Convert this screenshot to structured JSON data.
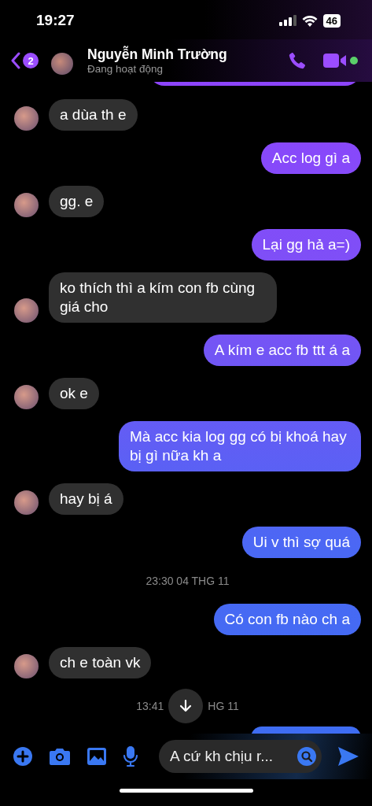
{
  "status_bar": {
    "time": "19:27",
    "battery": "46"
  },
  "header": {
    "back_count": "2",
    "name": "Nguyễn Minh Trường",
    "status": "Đang hoạt động",
    "online": true
  },
  "messages": [
    {
      "kind": "cut_out"
    },
    {
      "kind": "in",
      "text": "a dùa th e"
    },
    {
      "kind": "out",
      "text": "Acc log gì a"
    },
    {
      "kind": "in",
      "text": "gg. e"
    },
    {
      "kind": "out",
      "text": "Lại gg hả a=)"
    },
    {
      "kind": "in",
      "text": "ko thích thì a kím con fb cùng giá cho"
    },
    {
      "kind": "out",
      "text": "A kím e acc fb ttt á a"
    },
    {
      "kind": "in",
      "text": "ok e"
    },
    {
      "kind": "out",
      "text": "Mà acc kia log gg có bị khoá hay bị gì nữa kh a"
    },
    {
      "kind": "in",
      "text": "hay bị á"
    },
    {
      "kind": "out",
      "text": "Ui v thì sợ quá"
    },
    {
      "kind": "time",
      "text": "23:30 04 THG 11"
    },
    {
      "kind": "out",
      "text": "Có con fb nào ch a"
    },
    {
      "kind": "in",
      "text": "ch e toàn vk"
    },
    {
      "kind": "time_split",
      "left": "13:41",
      "right": "HG 11"
    },
    {
      "kind": "cut_out"
    }
  ],
  "composer": {
    "value": "A cứ kh chịu r..."
  }
}
